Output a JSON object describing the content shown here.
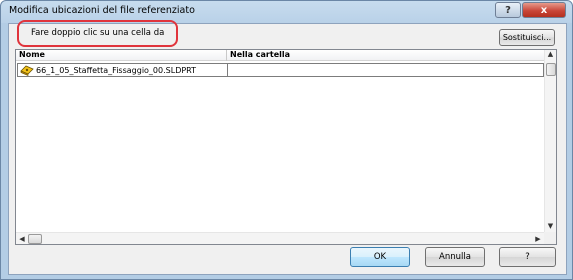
{
  "window": {
    "title": "Modifica ubicazioni del file referenziato",
    "help_glyph": "?",
    "close_glyph": "x"
  },
  "hint": {
    "text": "Fare doppio clic su una cella da"
  },
  "toolbar": {
    "replace_label": "Sostituisci..."
  },
  "grid": {
    "columns": [
      "Nome",
      "Nella cartella"
    ],
    "rows": [
      {
        "name": "66_1_05_Staffetta_Fissaggio_00.SLDPRT",
        "folder": ""
      }
    ],
    "icon": "solidworks-part-icon"
  },
  "scroll": {
    "up_glyph": "▲",
    "down_glyph": "▼",
    "left_glyph": "◀",
    "right_glyph": "▶"
  },
  "buttons": {
    "ok": "OK",
    "cancel": "Annulla",
    "help": "?"
  },
  "colors": {
    "highlight": "#e0343c",
    "close_button": "#c9473a"
  }
}
